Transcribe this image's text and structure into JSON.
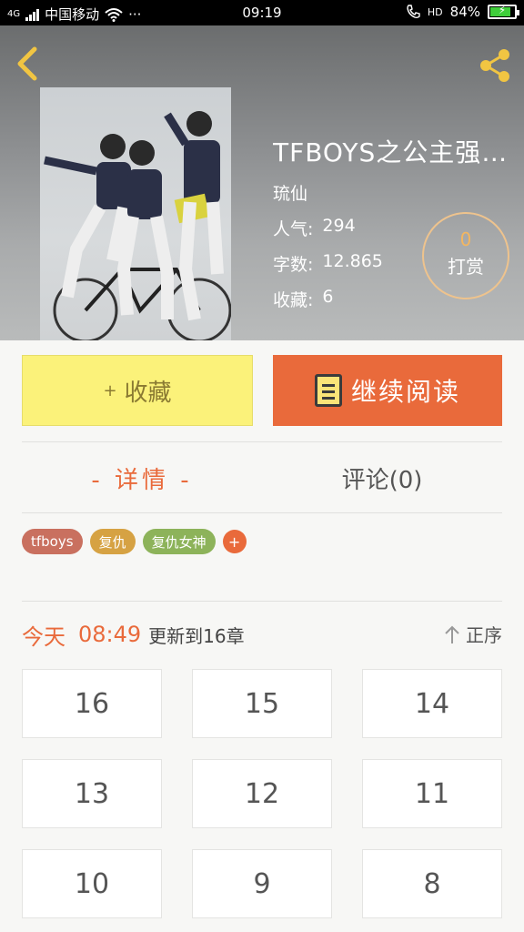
{
  "status_bar": {
    "network": "4G",
    "carrier": "中国移动",
    "more": "···",
    "time": "09:19",
    "hd": "HD",
    "battery": "84%",
    "battery_level": 0.84
  },
  "book": {
    "title": "TFBOYS之公主强…",
    "author": "琉仙",
    "popularity_label": "人气:",
    "popularity": "294",
    "wordcount_label": "字数:",
    "wordcount": "12.865",
    "favorites_label": "收藏:",
    "favorites": "6"
  },
  "tip": {
    "count": "0",
    "label": "打赏"
  },
  "actions": {
    "collect_plus": "+",
    "collect": "收藏",
    "read": "继续阅读"
  },
  "tabs": {
    "detail": "- 详情 -",
    "comment": "评论(0)"
  },
  "tags": [
    {
      "label": "tfboys",
      "color": "#c9705f"
    },
    {
      "label": "复仇",
      "color": "#d6a243"
    },
    {
      "label": "复仇女神",
      "color": "#8db35a"
    }
  ],
  "tag_add": "+",
  "update": {
    "day": "今天",
    "time": "08:49",
    "text": "更新到16章"
  },
  "sort": {
    "label": "正序"
  },
  "chapters": [
    "16",
    "15",
    "14",
    "13",
    "12",
    "11",
    "10",
    "9",
    "8"
  ],
  "colors": {
    "accent": "#e96a3b",
    "collect_bg": "#fbf27a",
    "tip_ring": "#eec38d"
  },
  "icons": {
    "back": "back-arrow-icon",
    "share": "share-icon",
    "book": "book-icon",
    "sort": "arrow-up-icon"
  }
}
